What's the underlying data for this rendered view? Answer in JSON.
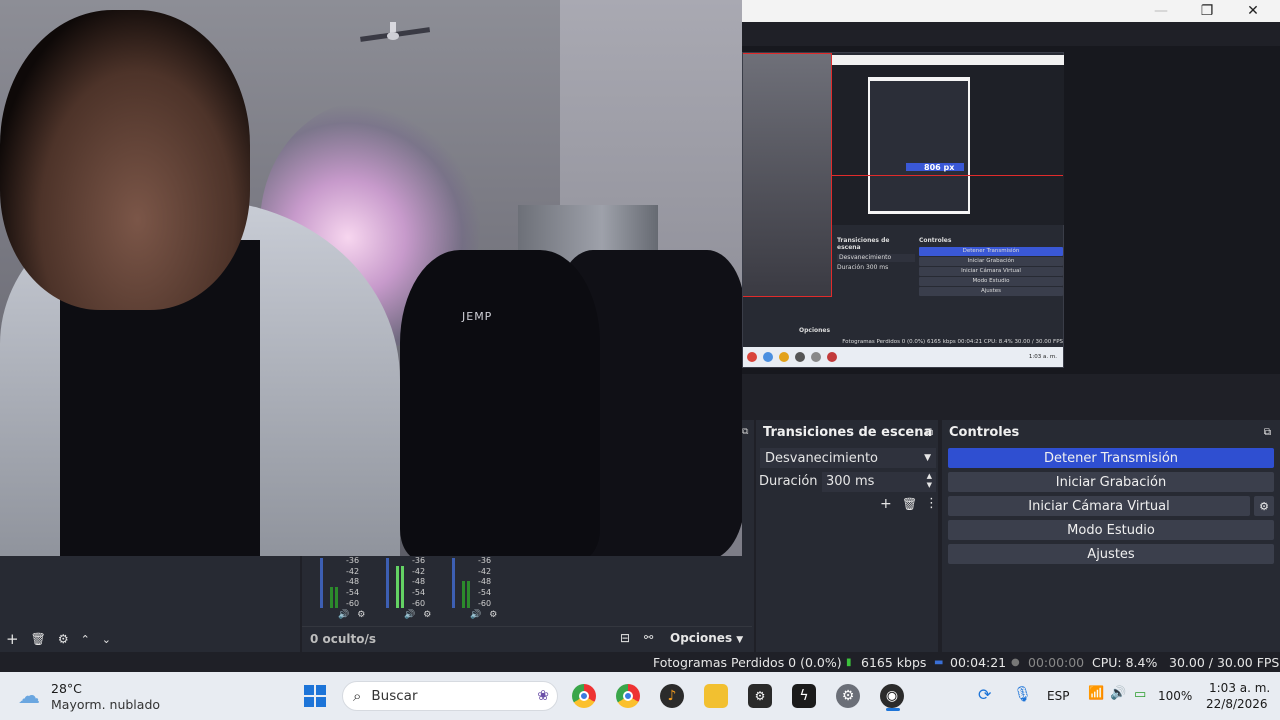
{
  "window": {
    "minimize_glyph": "—",
    "maximize_glyph": "❐",
    "close_glyph": "✕"
  },
  "webcam": {
    "brand_text": "JEMP"
  },
  "nested_preview": {
    "scene_transitions_label": "Transiciones de escena",
    "controls_label": "Controles",
    "transition_value": "Desvanecimiento",
    "duration_label": "Duración",
    "duration_value": "300 ms",
    "measure_label": "806 px",
    "buttons": [
      "Detener Transmisión",
      "Iniciar Grabación",
      "Iniciar Cámara Virtual",
      "Modo Estudio",
      "Ajustes"
    ],
    "options_label": "Opciones",
    "status": "Fotogramas Perdidos 0 (0.0%)   6165 kbps   00:04:21   CPU: 8.4%   30.00 / 30.00 FPS",
    "clock": "1:03 a. m."
  },
  "audio_mixer": {
    "db_labels": [
      "-36",
      "-42",
      "-48",
      "-54",
      "-60"
    ],
    "channels": [
      {
        "level": 0.42
      },
      {
        "level": 0.85
      },
      {
        "level": 0.55
      }
    ],
    "hidden_label": "0 oculto/s",
    "options_label": "Opciones"
  },
  "scenes_toolbar": {
    "icons": [
      "add-icon",
      "trash-icon",
      "gear-icon",
      "arrow-up-icon",
      "arrow-down-icon"
    ]
  },
  "transitions": {
    "title": "Transiciones de escena",
    "selected": "Desvanecimiento",
    "duration_label": "Duración",
    "duration_value": "300 ms"
  },
  "controls": {
    "title": "Controles",
    "buttons": [
      {
        "label": "Detener Transmisión",
        "primary": true
      },
      {
        "label": "Iniciar Grabación",
        "primary": false
      },
      {
        "label": "Iniciar Cámara Virtual",
        "primary": false
      },
      {
        "label": "Modo Estudio",
        "primary": false
      },
      {
        "label": "Ajustes",
        "primary": false
      }
    ]
  },
  "status_bar": {
    "dropped_frames": "Fotogramas Perdidos 0 (0.0%)",
    "bitrate": "6165 kbps",
    "stream_time": "00:04:21",
    "record_time": "00:00:00",
    "cpu": "CPU: 8.4%",
    "fps": "30.00 / 30.00 FPS"
  },
  "taskbar": {
    "weather_temp": "28°C",
    "weather_desc": "Mayorm. nublado",
    "search_placeholder": "Buscar",
    "language": "ESP",
    "battery": "100%",
    "time": "1:03 a. m.",
    "date": "22/8/2026"
  },
  "colors": {
    "accent": "#2f4fd1",
    "panel": "#272a33",
    "background": "#1f2027",
    "selection_red": "#e12b2b",
    "meter_green": "#2c8a2c",
    "meter_blue": "#3d5fb3"
  }
}
